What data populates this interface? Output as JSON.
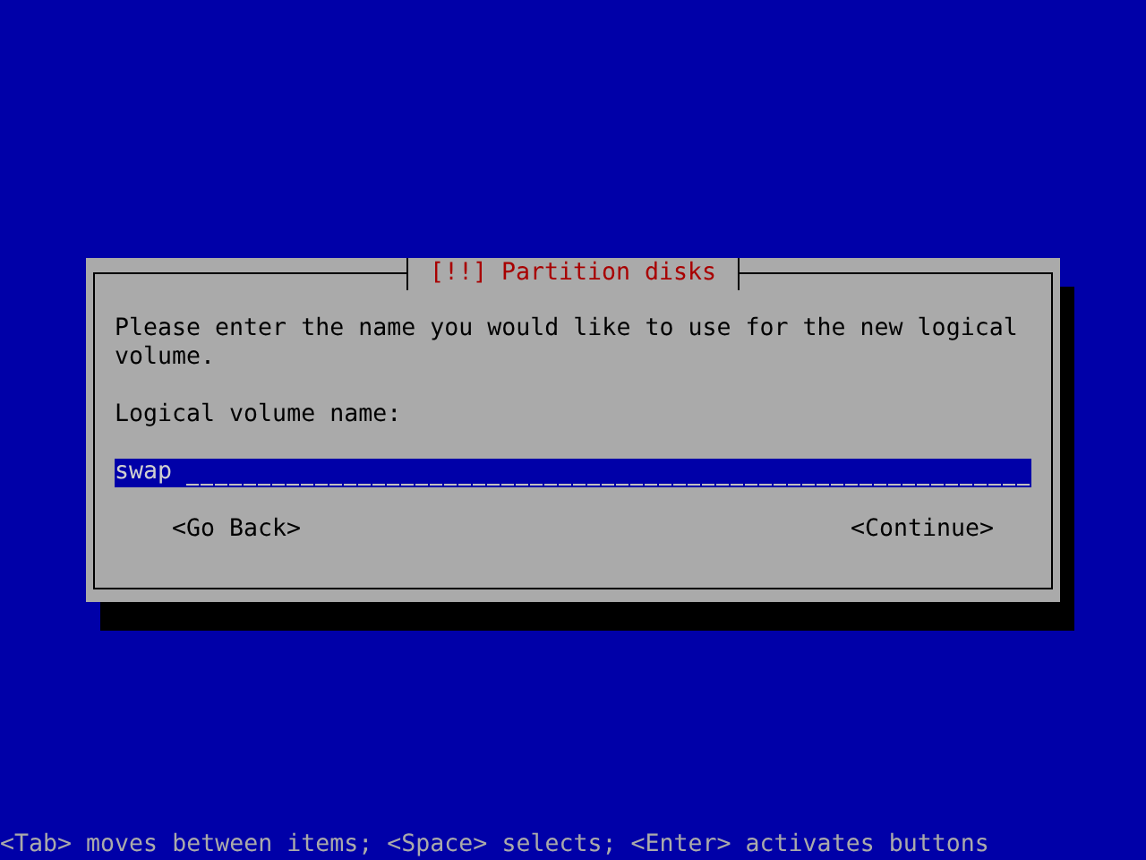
{
  "dialog": {
    "title": "[!!] Partition disks",
    "message": "Please enter the name you would like to use for the new logical volume.",
    "field": {
      "label": "Logical volume name:",
      "value": "swap"
    },
    "buttons": [
      {
        "label": "<Go Back>",
        "selected": false
      },
      {
        "label": "<Continue>",
        "selected": false
      }
    ]
  },
  "help_line": "<Tab> moves between items; <Space> selects; <Enter> activates buttons"
}
